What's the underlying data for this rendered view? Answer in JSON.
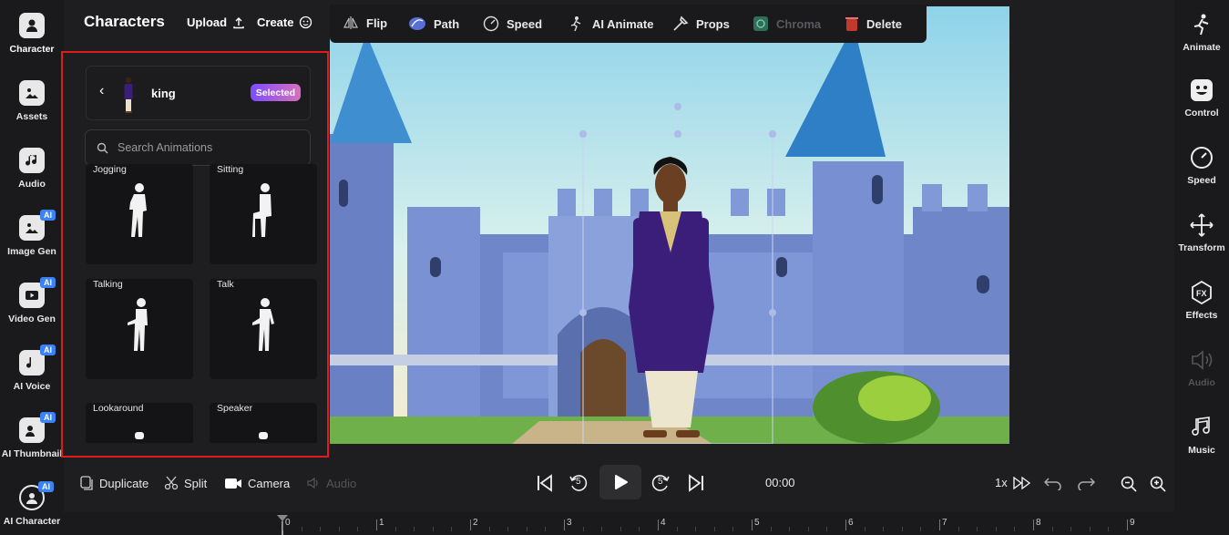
{
  "left_rail": [
    {
      "label": "Character",
      "icon": "character-icon",
      "ai": false
    },
    {
      "label": "Assets",
      "icon": "image-icon",
      "ai": false
    },
    {
      "label": "Audio",
      "icon": "music-note-icon",
      "ai": false
    },
    {
      "label": "Image Gen",
      "icon": "image-gen-icon",
      "ai": true
    },
    {
      "label": "Video Gen",
      "icon": "video-gen-icon",
      "ai": true
    },
    {
      "label": "AI Voice",
      "icon": "voice-icon",
      "ai": true
    },
    {
      "label": "AI Thumbnail",
      "icon": "thumbnail-icon",
      "ai": true
    },
    {
      "label": "AI Character",
      "icon": "ai-character-icon",
      "ai": true
    }
  ],
  "ai_badge": "AI",
  "panel": {
    "title": "Characters",
    "upload_label": "Upload",
    "create_label": "Create",
    "character_name": "king",
    "selected_label": "Selected",
    "search_placeholder": "Search Animations",
    "animations": [
      "Jogging",
      "Sitting",
      "Talking",
      "Talk",
      "Lookaround",
      "Speaker"
    ]
  },
  "toolbar": {
    "flip": "Flip",
    "path": "Path",
    "speed": "Speed",
    "ai_animate": "AI Animate",
    "props": "Props",
    "chroma": "Chroma",
    "delete": "Delete"
  },
  "right_rail": [
    "Animate",
    "Control",
    "Speed",
    "Transform",
    "Effects",
    "Audio",
    "Music"
  ],
  "bottom_bar": {
    "duplicate": "Duplicate",
    "split": "Split",
    "camera": "Camera",
    "audio": "Audio",
    "skip_back": "5",
    "skip_forward": "5",
    "time": "00:00",
    "speed": "1x"
  },
  "timeline": [
    "0",
    "1",
    "2",
    "3",
    "4",
    "5",
    "6",
    "7",
    "8",
    "9"
  ],
  "colors": {
    "accent_ai": "#3b82f6",
    "highlight": "#e01b1b",
    "selected_from": "#7c4dff",
    "selected_to": "#d86fbd"
  }
}
